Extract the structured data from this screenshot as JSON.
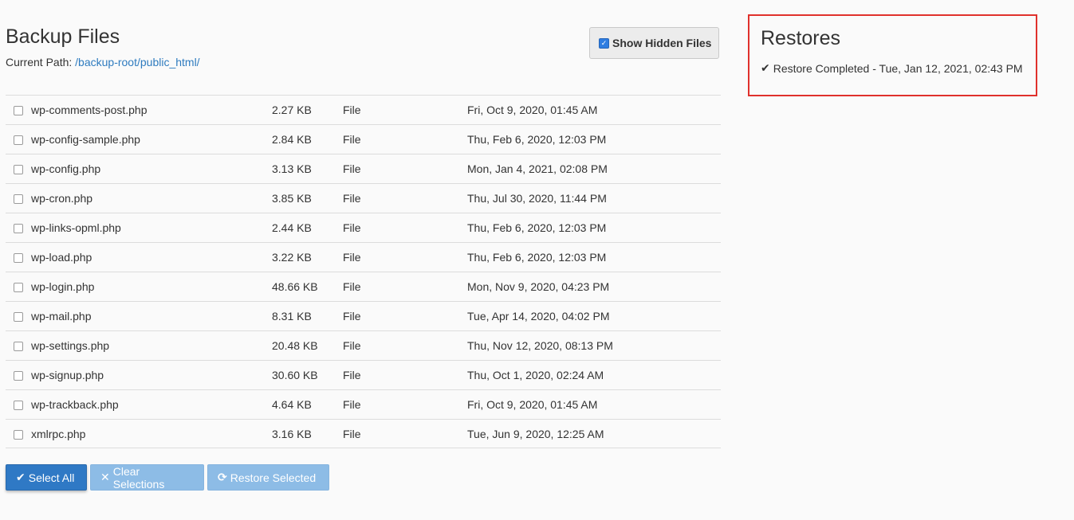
{
  "backup": {
    "title": "Backup Files",
    "path_label": "Current Path:",
    "path_value": "/backup-root/public_html/",
    "show_hidden_label": "Show Hidden Files",
    "show_hidden_checked": true
  },
  "files": [
    {
      "name": "wp-comments-post.php",
      "size": "2.27 KB",
      "type": "File",
      "date": "Fri, Oct 9, 2020, 01:45 AM"
    },
    {
      "name": "wp-config-sample.php",
      "size": "2.84 KB",
      "type": "File",
      "date": "Thu, Feb 6, 2020, 12:03 PM"
    },
    {
      "name": "wp-config.php",
      "size": "3.13 KB",
      "type": "File",
      "date": "Mon, Jan 4, 2021, 02:08 PM"
    },
    {
      "name": "wp-cron.php",
      "size": "3.85 KB",
      "type": "File",
      "date": "Thu, Jul 30, 2020, 11:44 PM"
    },
    {
      "name": "wp-links-opml.php",
      "size": "2.44 KB",
      "type": "File",
      "date": "Thu, Feb 6, 2020, 12:03 PM"
    },
    {
      "name": "wp-load.php",
      "size": "3.22 KB",
      "type": "File",
      "date": "Thu, Feb 6, 2020, 12:03 PM"
    },
    {
      "name": "wp-login.php",
      "size": "48.66 KB",
      "type": "File",
      "date": "Mon, Nov 9, 2020, 04:23 PM"
    },
    {
      "name": "wp-mail.php",
      "size": "8.31 KB",
      "type": "File",
      "date": "Tue, Apr 14, 2020, 04:02 PM"
    },
    {
      "name": "wp-settings.php",
      "size": "20.48 KB",
      "type": "File",
      "date": "Thu, Nov 12, 2020, 08:13 PM"
    },
    {
      "name": "wp-signup.php",
      "size": "30.60 KB",
      "type": "File",
      "date": "Thu, Oct 1, 2020, 02:24 AM"
    },
    {
      "name": "wp-trackback.php",
      "size": "4.64 KB",
      "type": "File",
      "date": "Fri, Oct 9, 2020, 01:45 AM"
    },
    {
      "name": "xmlrpc.php",
      "size": "3.16 KB",
      "type": "File",
      "date": "Tue, Jun 9, 2020, 12:25 AM"
    }
  ],
  "actions": {
    "select_all": "Select All",
    "clear_selections": "Clear Selections",
    "restore_selected": "Restore Selected"
  },
  "restores": {
    "title": "Restores",
    "status": "Restore Completed - Tue, Jan 12, 2021, 02:43 PM"
  },
  "colors": {
    "link": "#2e7bbf",
    "primary": "#2f79c5",
    "disabled": "#8dbce6",
    "highlight_border": "#e0312c"
  },
  "icons": {
    "select_all": "check-icon",
    "clear": "times-icon",
    "restore": "refresh-icon",
    "status": "check-icon"
  }
}
